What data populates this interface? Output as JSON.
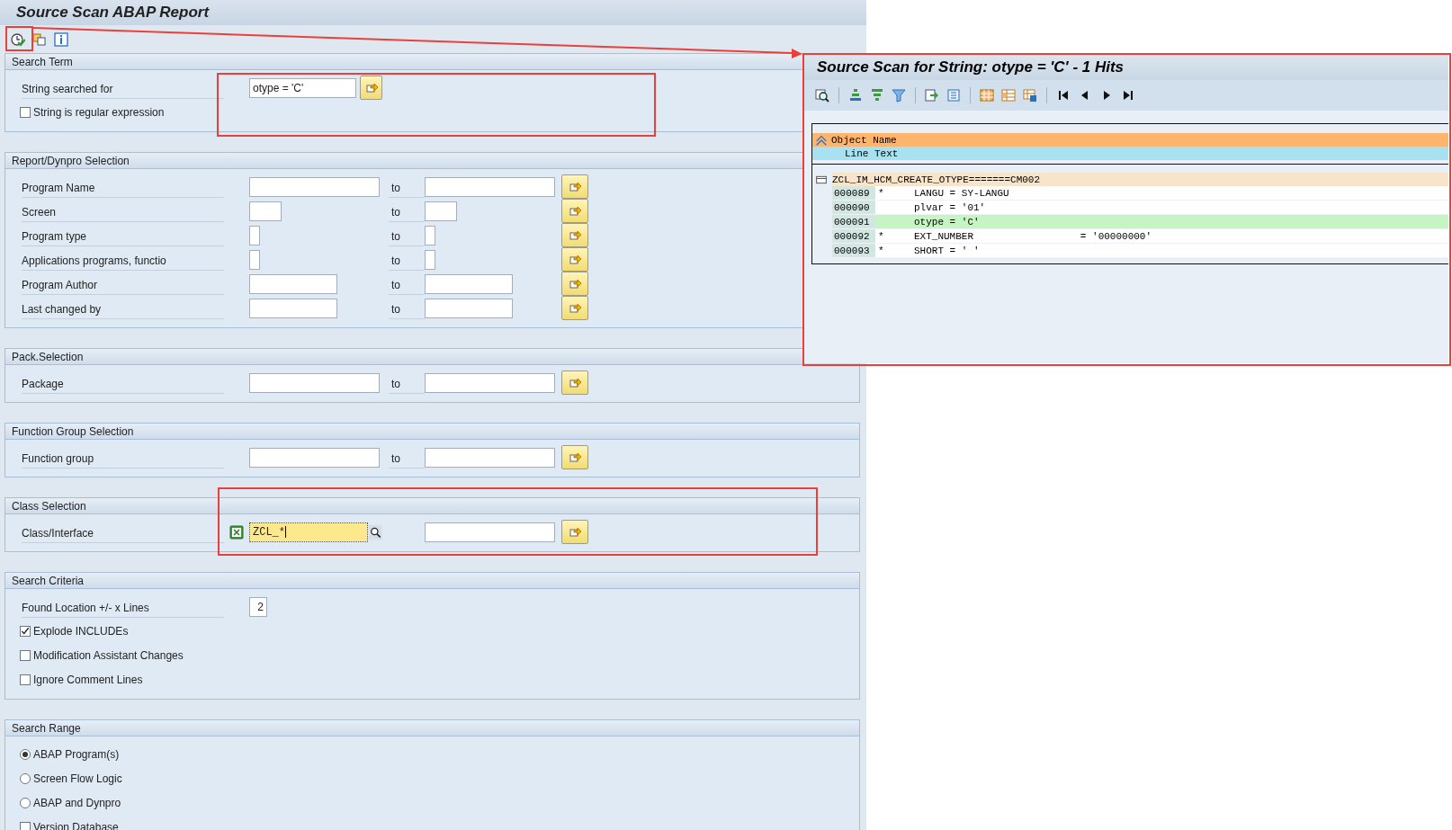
{
  "window": {
    "title": "Source Scan ABAP Report"
  },
  "sections": [
    {
      "title": "Search Term",
      "rows": [
        {
          "kind": "field",
          "label": "String searched for",
          "from": {
            "value": "otype = 'C'",
            "focused": false
          },
          "multi_button": true
        },
        {
          "kind": "checkbox",
          "label": "String is regular expression",
          "checked": false
        }
      ]
    },
    {
      "title": "Report/Dynpro Selection",
      "rows": [
        {
          "kind": "range",
          "label": "Program Name",
          "from": {
            "focused": false
          },
          "to_label": "to",
          "multi_button": true
        },
        {
          "kind": "range",
          "label": "Screen",
          "from": {
            "focused": false
          },
          "to_label": "to",
          "multi_button": true
        },
        {
          "kind": "range",
          "label": "Program type",
          "from": {
            "focused": false
          },
          "to_label": "to",
          "multi_button": true
        },
        {
          "kind": "range",
          "label": "Applications programs, functio",
          "from": {
            "focused": false
          },
          "to_label": "to",
          "multi_button": true
        },
        {
          "kind": "range",
          "label": "Program Author",
          "from": {
            "focused": false
          },
          "to_label": "to",
          "multi_button": true
        },
        {
          "kind": "range",
          "label": "Last changed by",
          "from": {
            "focused": false
          },
          "to_label": "to",
          "multi_button": true
        }
      ]
    },
    {
      "title": "Pack.Selection",
      "rows": [
        {
          "kind": "range",
          "label": "Package",
          "from": {
            "focused": false
          },
          "to_label": "to",
          "multi_button": true
        }
      ]
    },
    {
      "title": "Function Group Selection",
      "rows": [
        {
          "kind": "range",
          "label": "Function group",
          "from": {
            "focused": false
          },
          "to_label": "to",
          "multi_button": true
        }
      ]
    },
    {
      "title": "Class Selection",
      "rows": [
        {
          "kind": "range",
          "label": "Class/Interface",
          "selection_icon": true,
          "from": {
            "value": "ZCL_*",
            "focused": true
          },
          "search_help": true,
          "multi_button": true
        }
      ]
    },
    {
      "title": "Search Criteria",
      "rows": [
        {
          "kind": "number",
          "label": "Found Location +/- x Lines",
          "from": {
            "value": "2",
            "focused": false
          }
        },
        {
          "kind": "checkbox",
          "label": "Explode INCLUDEs",
          "checked": true
        },
        {
          "kind": "checkbox",
          "label": "Modification Assistant Changes",
          "checked": false
        },
        {
          "kind": "checkbox",
          "label": "Ignore Comment Lines",
          "checked": false
        }
      ]
    },
    {
      "title": "Search Range",
      "rows": [
        {
          "kind": "radio",
          "label": "ABAP Program(s)",
          "selected": true
        },
        {
          "kind": "radio",
          "label": "Screen Flow Logic",
          "selected": false
        },
        {
          "kind": "radio",
          "label": "ABAP and Dynpro",
          "selected": false
        },
        {
          "kind": "checkbox",
          "label": "Version Database",
          "checked": false
        }
      ]
    }
  ],
  "result": {
    "title": "Source Scan for String: otype = 'C' - 1 Hits",
    "header": [
      "Object Name",
      "Line Text"
    ],
    "object": "ZCL_IM_HCM_CREATE_OTYPE=======CM002",
    "lines": [
      {
        "number": "000089",
        "marker": "*",
        "text": "LANGU = SY-LANGU",
        "highlighted": false
      },
      {
        "number": "000090",
        "text": "plvar = '01'",
        "highlighted": false
      },
      {
        "number": "000091",
        "text": "otype = 'C'",
        "highlighted": true
      },
      {
        "number": "000092",
        "marker": "*",
        "text": "EXT_NUMBER                  = '00000000'",
        "highlighted": false
      },
      {
        "number": "000093",
        "marker": "*",
        "text": "SHORT = ' '",
        "highlighted": false
      }
    ]
  }
}
